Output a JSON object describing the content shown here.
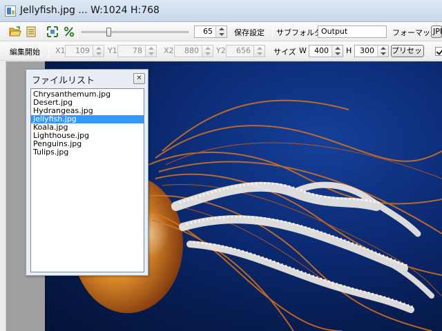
{
  "window": {
    "title": "Jellyfish.jpg ... W:1024 H:768"
  },
  "toolbar1": {
    "quality_value": "65",
    "save_settings_label": "保存設定",
    "subfolder_label": "サブフォルダ",
    "subfolder_value": "Output",
    "format_label": "フォーマット",
    "format_value": "JPEG"
  },
  "toolbar2": {
    "edit_start_label": "編集開始",
    "x1_label": "X1",
    "x1_value": "109",
    "y1_label": "Y1",
    "y1_value": "78",
    "x2_label": "X2",
    "x2_value": "880",
    "y2_label": "Y2",
    "y2_value": "656",
    "size_label": "サイズ",
    "w_label": "W",
    "w_value": "400",
    "h_label": "H",
    "h_value": "300",
    "preset_label": "プリセット"
  },
  "file_panel": {
    "title": "ファイルリスト",
    "close_glyph": "✕",
    "files": [
      "Chrysanthemum.jpg",
      "Desert.jpg",
      "Hydrangeas.jpg",
      "Jellyfish.jpg",
      "Koala.jpg",
      "Lighthouse.jpg",
      "Penguins.jpg",
      "Tulips.jpg"
    ],
    "selected_index": 3
  }
}
